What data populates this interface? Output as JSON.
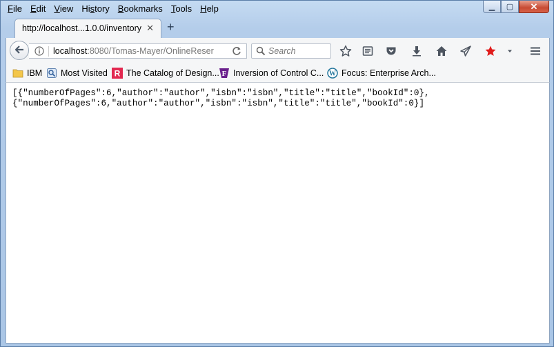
{
  "menu": {
    "items": [
      {
        "mnemonic": "F",
        "rest": "ile"
      },
      {
        "mnemonic": "E",
        "rest": "dit"
      },
      {
        "mnemonic": "V",
        "rest": "iew"
      },
      {
        "pre": "Hi",
        "mnemonic": "s",
        "rest": "tory"
      },
      {
        "mnemonic": "B",
        "rest": "ookmarks"
      },
      {
        "mnemonic": "T",
        "rest": "ools"
      },
      {
        "mnemonic": "H",
        "rest": "elp"
      }
    ]
  },
  "window": {
    "minimize_glyph": "▁",
    "maximize_glyph": "▢",
    "close_glyph": "✕"
  },
  "tab": {
    "title": "http://localhost...1.0.0/inventory",
    "close_glyph": "✕",
    "new_tab_glyph": "+"
  },
  "navbar": {
    "url_host": "localhost",
    "url_rest": ":8080/Tomas-Mayer/OnlineReser",
    "search_placeholder": "Search",
    "icons": [
      "back-icon",
      "info-icon",
      "reload-icon",
      "search-icon",
      "bookmark-star-icon",
      "reading-list-icon",
      "pocket-icon",
      "download-icon",
      "home-icon",
      "send-icon",
      "red-star-icon",
      "dropdown-icon",
      "menu-icon"
    ]
  },
  "bookmarks": [
    {
      "label": "IBM",
      "icon": "folder-icon"
    },
    {
      "label": "Most Visited",
      "icon": "most-visited-icon"
    },
    {
      "label": "The Catalog of Design...",
      "icon": "r-logo-icon"
    },
    {
      "label": "Inversion of Control C...",
      "icon": "f-logo-icon"
    },
    {
      "label": "Focus: Enterprise Arch...",
      "icon": "wordpress-icon"
    }
  ],
  "colors": {
    "accent_red": "#e22850",
    "star_red": "#e01b1b",
    "close_button": "#c74a33"
  },
  "content": {
    "body_text": "[{\"numberOfPages\":6,\"author\":\"author\",\"isbn\":\"isbn\",\"title\":\"title\",\"bookId\":0},\n{\"numberOfPages\":6,\"author\":\"author\",\"isbn\":\"isbn\",\"title\":\"title\",\"bookId\":0}]"
  }
}
